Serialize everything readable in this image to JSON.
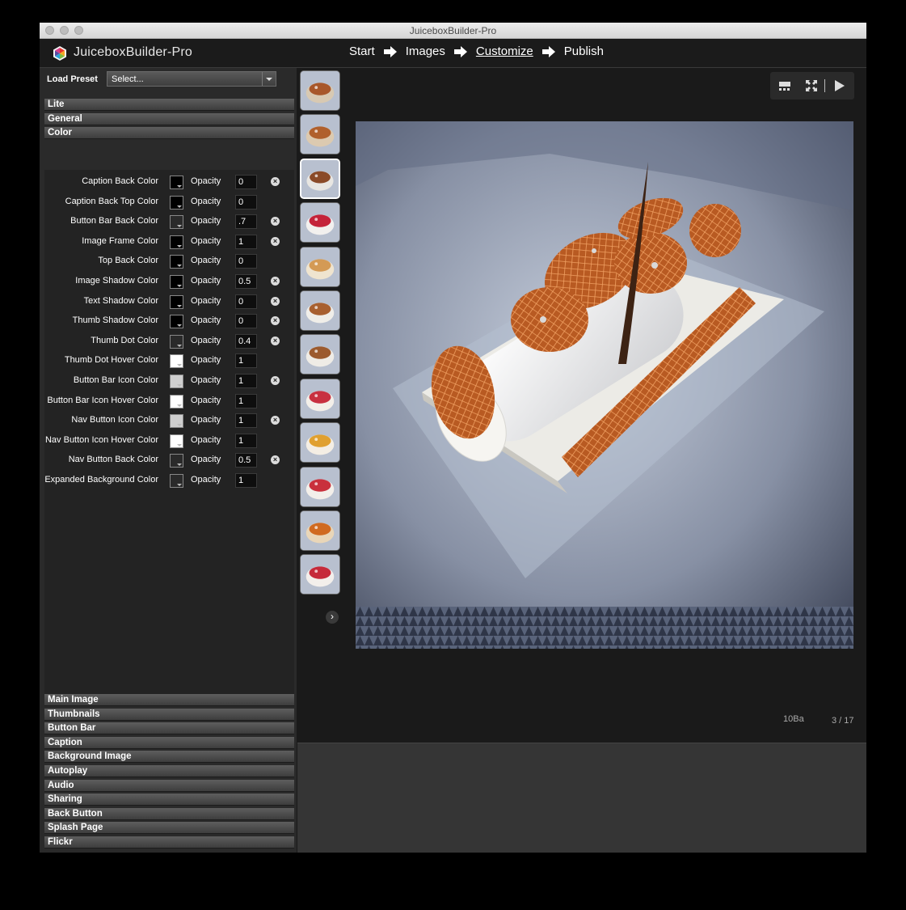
{
  "window": {
    "title": "JuiceboxBuilder-Pro"
  },
  "app": {
    "name": "JuiceboxBuilder-Pro"
  },
  "nav": {
    "steps": [
      "Start",
      "Images",
      "Customize",
      "Publish"
    ],
    "active": "Customize"
  },
  "left": {
    "load_preset_label": "Load Preset",
    "preset_select_value": "Select...",
    "top_sections": [
      "Lite",
      "General",
      "Color"
    ],
    "opacity_label": "Opacity",
    "color_rows": [
      {
        "label": "Caption Back Color",
        "swatch": "#000000",
        "opacity": "0",
        "reset": true
      },
      {
        "label": "Caption Back Top Color",
        "swatch": "#000000",
        "opacity": "0",
        "reset": false
      },
      {
        "label": "Button Bar Back Color",
        "swatch": "#2a2a2a",
        "opacity": ".7",
        "reset": true
      },
      {
        "label": "Image Frame Color",
        "swatch": "#000000",
        "opacity": "1",
        "reset": true
      },
      {
        "label": "Top Back Color",
        "swatch": "#000000",
        "opacity": "0",
        "reset": false
      },
      {
        "label": "Image Shadow Color",
        "swatch": "#000000",
        "opacity": "0.5",
        "reset": true
      },
      {
        "label": "Text Shadow Color",
        "swatch": "#000000",
        "opacity": "0",
        "reset": true
      },
      {
        "label": "Thumb Shadow Color",
        "swatch": "#000000",
        "opacity": "0",
        "reset": true
      },
      {
        "label": "Thumb Dot Color",
        "swatch": "#2a2a2a",
        "opacity": "0.4",
        "reset": true
      },
      {
        "label": "Thumb Dot Hover Color",
        "swatch": "#ffffff",
        "opacity": "1",
        "reset": false
      },
      {
        "label": "Button Bar Icon Color",
        "swatch": "#cfcfcf",
        "opacity": "1",
        "reset": true
      },
      {
        "label": "Button Bar Icon Hover Color",
        "swatch": "#ffffff",
        "opacity": "1",
        "reset": false
      },
      {
        "label": "Nav Button Icon Color",
        "swatch": "#cfcfcf",
        "opacity": "1",
        "reset": true
      },
      {
        "label": "Nav Button Icon Hover Color",
        "swatch": "#ffffff",
        "opacity": "1",
        "reset": false
      },
      {
        "label": "Nav Button Back Color",
        "swatch": "#2a2a2a",
        "opacity": "0.5",
        "reset": true
      },
      {
        "label": "Expanded Background Color",
        "swatch": "#2a2a2a",
        "opacity": "1",
        "reset": false
      }
    ],
    "bottom_sections": [
      "Main Image",
      "Thumbnails",
      "Button Bar",
      "Caption",
      "Background Image",
      "Autoplay",
      "Audio",
      "Sharing",
      "Back Button",
      "Splash Page",
      "Flickr"
    ]
  },
  "stage": {
    "caption": "10Ba",
    "counter": "3 / 17",
    "selected_thumb_index": 2
  },
  "colors": {
    "stage_bg": "#1a1a1a",
    "panel_bg": "#2a2a2a"
  }
}
